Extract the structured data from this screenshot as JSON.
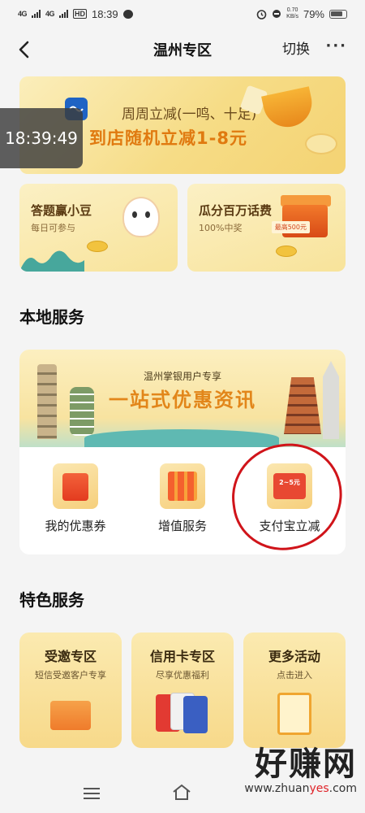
{
  "status_bar": {
    "net1": "4G",
    "net2": "4G",
    "hd": "HD",
    "time": "18:39",
    "net_speed_value": "0.70",
    "net_speed_unit": "KB/s",
    "battery": "79%"
  },
  "nav": {
    "title": "温州专区",
    "switch_label": "切换",
    "more_label": "···"
  },
  "banner": {
    "line1": "周周立减(一鸣、十足)",
    "line2": "到店随机立减1-8元"
  },
  "time_overlay": "18:39:49",
  "promos": [
    {
      "title": "答题赢小豆",
      "subtitle": "每日可参与"
    },
    {
      "title": "瓜分百万话费",
      "subtitle": "100%中奖",
      "tag": "最高500元"
    }
  ],
  "local_services": {
    "section_title": "本地服务",
    "banner_sub": "温州掌银用户专享",
    "banner_main": "一站式优惠资讯",
    "items": [
      {
        "label": "我的优惠券"
      },
      {
        "label": "增值服务"
      },
      {
        "label": "支付宝立减",
        "icon_text": "2~5元"
      }
    ]
  },
  "featured_services": {
    "section_title": "特色服务",
    "items": [
      {
        "title": "受邀专区",
        "subtitle": "短信受邀客户专享"
      },
      {
        "title": "信用卡专区",
        "subtitle": "尽享优惠福利"
      },
      {
        "title": "更多活动",
        "subtitle": "点击进入"
      }
    ]
  },
  "watermark": {
    "text": "好赚网",
    "url_prefix": "www.zhuan",
    "url_accent": "yes",
    "url_suffix": ".com"
  },
  "colors": {
    "accent_orange": "#e07a10",
    "annotation_red": "#d0141a"
  }
}
